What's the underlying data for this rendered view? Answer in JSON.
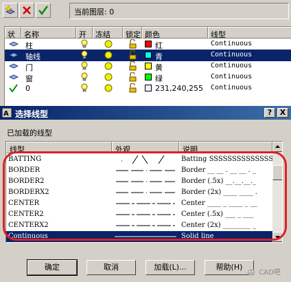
{
  "layer_manager": {
    "current_layer_label": "当前图层: 0",
    "columns": [
      "状",
      "名称",
      "开",
      "冻结",
      "锁定",
      "颜色",
      "线型"
    ],
    "layers": [
      {
        "status": "sheet",
        "name": "柱",
        "color_name": "红",
        "color_hex": "#ff0000",
        "linetype": "Continuous",
        "selected": false
      },
      {
        "status": "sheet",
        "name": "轴线",
        "color_name": "青",
        "color_hex": "#00ffff",
        "linetype": "Continuous",
        "selected": true
      },
      {
        "status": "sheet",
        "name": "门",
        "color_name": "黄",
        "color_hex": "#ffff00",
        "linetype": "Continuous",
        "selected": false
      },
      {
        "status": "sheet",
        "name": "窗",
        "color_name": "绿",
        "color_hex": "#00ff00",
        "linetype": "Continuous",
        "selected": false
      },
      {
        "status": "check",
        "name": "0",
        "color_name": "231,240,255",
        "color_hex": "#e7f0ff",
        "linetype": "Continuous",
        "selected": false
      }
    ]
  },
  "dialog": {
    "title": "选择线型",
    "help_btn": "?",
    "close_btn": "X",
    "loaded_label": "已加载的线型",
    "columns": [
      "线型",
      "外观",
      "说明"
    ],
    "linetypes": [
      {
        "name": "BATTING",
        "desc": "Batting SSSSSSSSSSSSSSSS",
        "pattern": "batting",
        "selected": false
      },
      {
        "name": "BORDER",
        "desc": "Border __ __ . __ __ . _",
        "pattern": "border",
        "selected": false
      },
      {
        "name": "BORDER2",
        "desc": "Border (.5x) __.__.__._",
        "pattern": "border",
        "selected": false
      },
      {
        "name": "BORDERX2",
        "desc": "Border (2x) ____ ____ .",
        "pattern": "border",
        "selected": false
      },
      {
        "name": "CENTER",
        "desc": "Center ____ _ ____ _ __",
        "pattern": "center",
        "selected": false
      },
      {
        "name": "CENTER2",
        "desc": "Center (.5x) ___ _ ___",
        "pattern": "center",
        "selected": false
      },
      {
        "name": "CENTERX2",
        "desc": "Center (2x) ________ _",
        "pattern": "center",
        "selected": false
      },
      {
        "name": "Continuous",
        "desc": "Solid line",
        "pattern": "solid",
        "selected": true
      }
    ],
    "buttons": {
      "ok": "确定",
      "cancel": "取消",
      "load": "加载(L)...",
      "help": "帮助(H)"
    },
    "highlight_color": "#e02020"
  },
  "watermark": "CAD吧"
}
